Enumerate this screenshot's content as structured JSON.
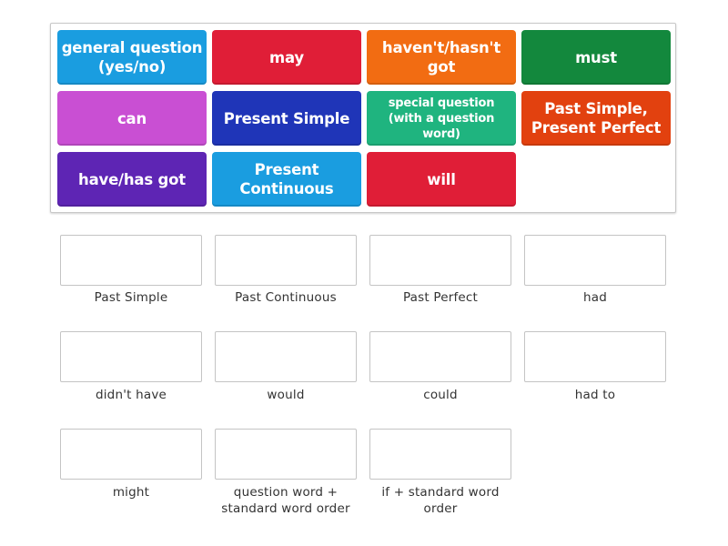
{
  "tiles": [
    {
      "text": "general question (yes/no)",
      "color": "#1a9de0"
    },
    {
      "text": "may",
      "color": "#e01e37"
    },
    {
      "text": "haven't/hasn't got",
      "color": "#f26c12"
    },
    {
      "text": "must",
      "color": "#13883d"
    },
    {
      "text": "can",
      "color": "#c94fd3"
    },
    {
      "text": "Present Simple",
      "color": "#1f35b8"
    },
    {
      "text": "special question (with a question word)",
      "color": "#1fb47f"
    },
    {
      "text": "Past Simple, Present Perfect",
      "color": "#e2410f"
    },
    {
      "text": "have/has got",
      "color": "#5e25b4"
    },
    {
      "text": "Present Continuous",
      "color": "#1a9de0"
    },
    {
      "text": "will",
      "color": "#e01e37"
    }
  ],
  "targets": [
    {
      "label": "Past Simple"
    },
    {
      "label": "Past Continuous"
    },
    {
      "label": "Past Perfect"
    },
    {
      "label": "had"
    },
    {
      "label": "didn't have"
    },
    {
      "label": "would"
    },
    {
      "label": "could"
    },
    {
      "label": "had to"
    },
    {
      "label": "might"
    },
    {
      "label": "question word + standard word order"
    },
    {
      "label": "if + standard word order"
    }
  ]
}
